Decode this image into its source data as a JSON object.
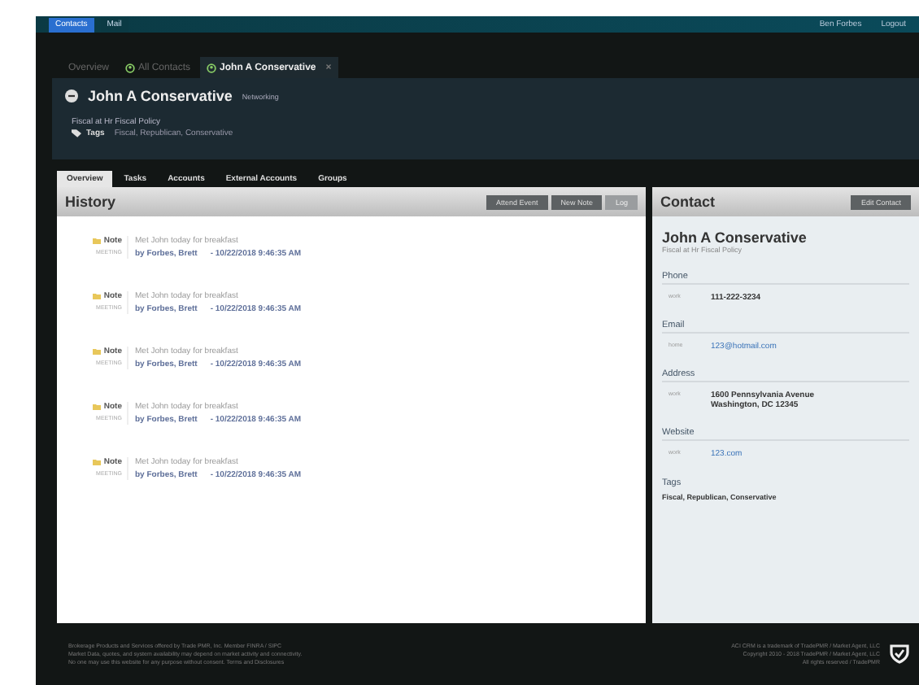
{
  "top_bar": {
    "buttons": [
      {
        "label": "Contacts",
        "selected": true
      },
      {
        "label": "Mail",
        "selected": false
      }
    ],
    "user": "Ben Forbes",
    "logout": "Logout"
  },
  "page_tabs": [
    {
      "label": "Overview",
      "selected": false
    },
    {
      "label": "All Contacts",
      "selected": false
    },
    {
      "label": "John A Conservative",
      "selected": true,
      "close": "×"
    }
  ],
  "header": {
    "name": "John A Conservative",
    "category": "Networking",
    "subtitle": "Fiscal at Hr Fiscal Policy",
    "tags_label": "Tags",
    "tags": "Fiscal, Republican, Conservative"
  },
  "section_tabs": [
    {
      "label": "Overview",
      "selected": true
    },
    {
      "label": "Tasks",
      "selected": false
    },
    {
      "label": "Accounts",
      "selected": false
    },
    {
      "label": "External Accounts",
      "selected": false
    },
    {
      "label": "Groups",
      "selected": false
    }
  ],
  "history": {
    "title": "History",
    "buttons": [
      {
        "label": "Attend Event",
        "disabled": false
      },
      {
        "label": "New Note",
        "disabled": false
      },
      {
        "label": "Log",
        "disabled": true
      }
    ],
    "items": [
      {
        "type": "Note",
        "subtype": "MEETING",
        "text": "Met John today for breakfast",
        "author": "by Forbes, Brett",
        "date": "- 10/22/2018 9:46:35 AM"
      },
      {
        "type": "Note",
        "subtype": "MEETING",
        "text": "Met John today for breakfast",
        "author": "by Forbes, Brett",
        "date": "- 10/22/2018 9:46:35 AM"
      },
      {
        "type": "Note",
        "subtype": "MEETING",
        "text": "Met John today for breakfast",
        "author": "by Forbes, Brett",
        "date": "- 10/22/2018 9:46:35 AM"
      },
      {
        "type": "Note",
        "subtype": "MEETING",
        "text": "Met John today for breakfast",
        "author": "by Forbes, Brett",
        "date": "- 10/22/2018 9:46:35 AM"
      },
      {
        "type": "Note",
        "subtype": "MEETING",
        "text": "Met John today for breakfast",
        "author": "by Forbes, Brett",
        "date": "- 10/22/2018 9:46:35 AM"
      }
    ]
  },
  "contact": {
    "title": "Contact",
    "edit_button": "Edit Contact",
    "name": "John A Conservative",
    "subtitle": "Fiscal at Hr Fiscal Policy",
    "sections": [
      {
        "title": "Phone",
        "kind": "text",
        "type": "work",
        "lines": [
          "111-222-3234"
        ]
      },
      {
        "title": "Email",
        "kind": "link",
        "type": "home",
        "lines": [
          "123@hotmail.com"
        ]
      },
      {
        "title": "Address",
        "kind": "text",
        "type": "work",
        "lines": [
          "1600 Pennsylvania Avenue",
          "Washington, DC 12345"
        ]
      },
      {
        "title": "Website",
        "kind": "link",
        "type": "work",
        "lines": [
          "123.com"
        ]
      }
    ],
    "tags_title": "Tags",
    "tags": "Fiscal, Republican, Conservative"
  },
  "footer": {
    "left": [
      "Brokerage Products and Services offered by Trade PMR, Inc. Member FINRA / SIPC",
      "Market Data, quotes, and system availability may depend on market activity and connectivity.",
      "No one may use this website for any purpose without consent.  Terms and Disclosures"
    ],
    "right": [
      "ACI CRM is a trademark of TradePMR / Market Agent, LLC",
      "Copyright 2010 - 2018 TradePMR / Market Agent, LLC",
      "All rights reserved / TradePMR"
    ]
  }
}
